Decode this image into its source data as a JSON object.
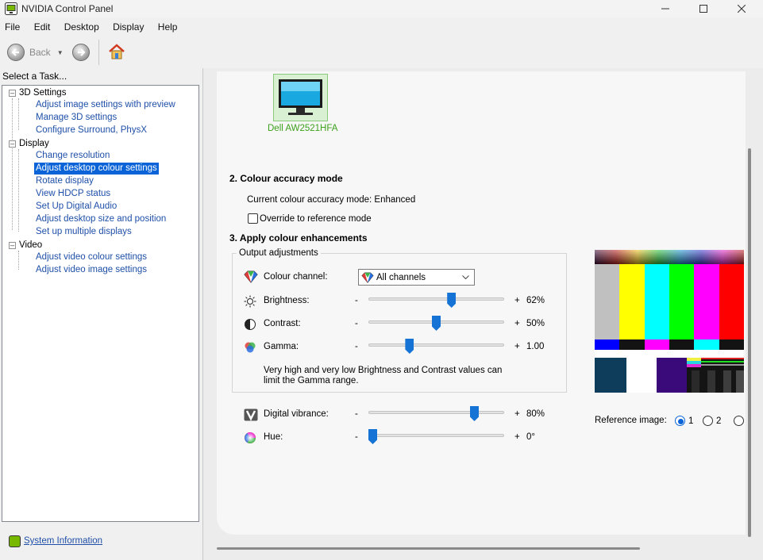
{
  "window": {
    "title": "NVIDIA Control Panel"
  },
  "menu": [
    "File",
    "Edit",
    "Desktop",
    "Display",
    "Help"
  ],
  "toolbar": {
    "back_label": "Back"
  },
  "sidebar": {
    "header": "Select a Task...",
    "categories": [
      {
        "label": "3D Settings",
        "items": [
          "Adjust image settings with preview",
          "Manage 3D settings",
          "Configure Surround, PhysX"
        ]
      },
      {
        "label": "Display",
        "items": [
          "Change resolution",
          "Adjust desktop colour settings",
          "Rotate display",
          "View HDCP status",
          "Set Up Digital Audio",
          "Adjust desktop size and position",
          "Set up multiple displays"
        ]
      },
      {
        "label": "Video",
        "items": [
          "Adjust video colour settings",
          "Adjust video image settings"
        ]
      }
    ],
    "selected_item": "Adjust desktop colour settings",
    "system_info": "System Information"
  },
  "main": {
    "monitor": {
      "name": "Dell AW2521HFA"
    },
    "section2": {
      "title": "2. Colour accuracy mode",
      "current_mode": "Current colour accuracy mode: Enhanced",
      "override_label": "Override to reference mode",
      "override_checked": false
    },
    "section3": {
      "title": "3. Apply colour enhancements",
      "group_label": "Output adjustments",
      "channel": {
        "label": "Colour channel:",
        "value": "All channels"
      },
      "sliders": [
        {
          "label": "Brightness:",
          "minus": "-",
          "plus": "+",
          "value": "62%",
          "level": 0.62,
          "icon": "sun-icon"
        },
        {
          "label": "Contrast:",
          "minus": "-",
          "plus": "+",
          "value": "50%",
          "level": 0.5,
          "icon": "contrast-icon"
        },
        {
          "label": "Gamma:",
          "minus": "-",
          "plus": "+",
          "value": "1.00",
          "level": 0.29,
          "icon": "gamma-icon"
        }
      ],
      "note": "Very high and very low Brightness and Contrast values can limit the Gamma range.",
      "extra_sliders": [
        {
          "label": "Digital vibrance:",
          "minus": "-",
          "plus": "+",
          "value": "80%",
          "level": 0.8,
          "icon": "vibrance-icon"
        },
        {
          "label": "Hue:",
          "minus": "-",
          "plus": "+",
          "value": "0°",
          "level": 0.0,
          "icon": "hue-icon"
        }
      ]
    },
    "reference": {
      "label": "Reference image:",
      "options": [
        "1",
        "2",
        ""
      ],
      "selected": "1"
    }
  },
  "colors": {
    "accent": "#0a64d8",
    "nvidia_green": "#76b900",
    "link": "#1f4fa8",
    "slider_thumb": "#1573d6"
  }
}
